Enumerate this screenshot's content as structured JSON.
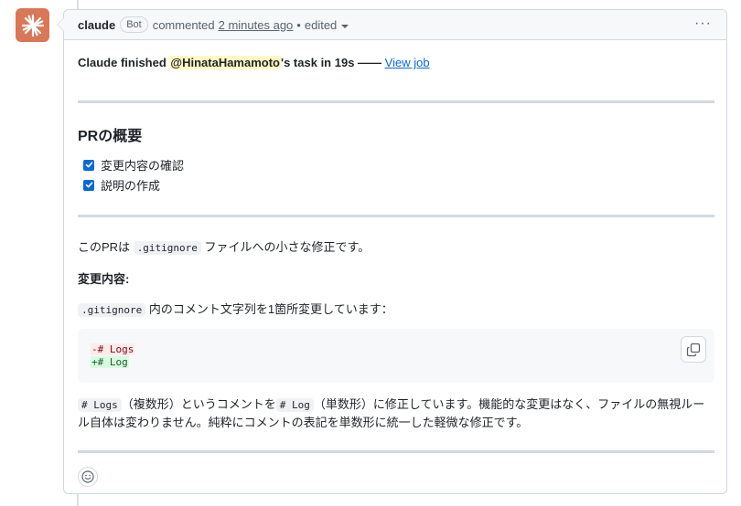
{
  "header": {
    "author": "claude",
    "badge": "Bot",
    "action": "commented",
    "time": "2 minutes ago",
    "separator": "•",
    "edited": "edited",
    "more": "···"
  },
  "status": {
    "prefix": "Claude finished ",
    "mention": "@HinataHamamoto",
    "suffix": "'s task in 19s ——",
    "link": "View job"
  },
  "summary": {
    "title": "PRの概要",
    "tasks": [
      {
        "label": "変更内容の確認",
        "checked": true
      },
      {
        "label": "説明の作成",
        "checked": true
      }
    ]
  },
  "description": {
    "p1_before": "このPRは",
    "p1_code": ".gitignore",
    "p1_after": "ファイルへの小さな修正です。",
    "changes_heading": "変更内容:",
    "p2_code": ".gitignore",
    "p2_after": "内のコメント文字列を1箇所変更しています："
  },
  "code": {
    "removed": "-# Logs",
    "added": "+# Log"
  },
  "explanation": {
    "code1": "# Logs",
    "text1": "（複数形）というコメントを",
    "code2": "# Log",
    "text2": "（単数形）に修正しています。機能的な変更はなく、ファイルの無視ルール自体は変わりません。純粋にコメントの表記を単数形に統一した軽微な修正です。"
  },
  "colors": {
    "avatar": "#d97757",
    "link": "#0969da",
    "mention_bg": "#fff8c5"
  }
}
